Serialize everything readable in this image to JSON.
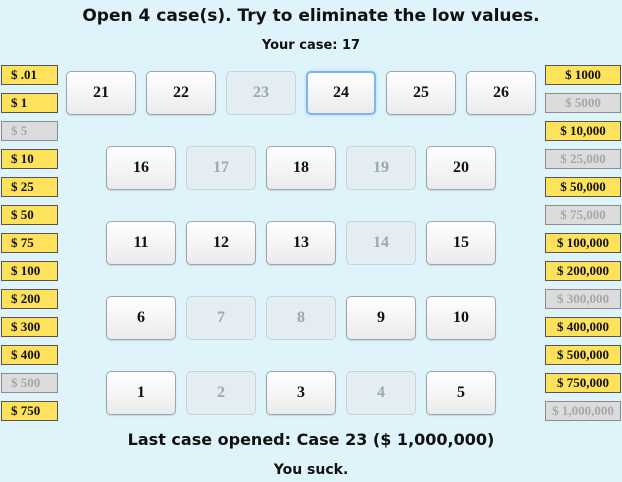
{
  "header": {
    "title": "Open 4 case(s). Try to eliminate the low values.",
    "your_case": "Your case: 17"
  },
  "footer": {
    "last_case": "Last case opened: Case 23 ($ 1,000,000)",
    "verdict": "You suck."
  },
  "colors": {
    "background": "#dff3fb",
    "prize_remaining": "#ffe25b",
    "prize_eliminated": "#dcdcdc",
    "selected_case_border": "#7fb6e6"
  },
  "prizes_left": [
    {
      "label": "$ .01",
      "eliminated": false
    },
    {
      "label": "$ 1",
      "eliminated": false
    },
    {
      "label": "$ 5",
      "eliminated": true
    },
    {
      "label": "$ 10",
      "eliminated": false
    },
    {
      "label": "$ 25",
      "eliminated": false
    },
    {
      "label": "$ 50",
      "eliminated": false
    },
    {
      "label": "$ 75",
      "eliminated": false
    },
    {
      "label": "$ 100",
      "eliminated": false
    },
    {
      "label": "$ 200",
      "eliminated": false
    },
    {
      "label": "$ 300",
      "eliminated": false
    },
    {
      "label": "$ 400",
      "eliminated": false
    },
    {
      "label": "$ 500",
      "eliminated": true
    },
    {
      "label": "$ 750",
      "eliminated": false
    }
  ],
  "prizes_right": [
    {
      "label": "$ 1000",
      "eliminated": false
    },
    {
      "label": "$ 5000",
      "eliminated": true
    },
    {
      "label": "$ 10,000",
      "eliminated": false
    },
    {
      "label": "$ 25,000",
      "eliminated": true
    },
    {
      "label": "$ 50,000",
      "eliminated": false
    },
    {
      "label": "$ 75,000",
      "eliminated": true
    },
    {
      "label": "$ 100,000",
      "eliminated": false
    },
    {
      "label": "$ 200,000",
      "eliminated": false
    },
    {
      "label": "$ 300,000",
      "eliminated": true
    },
    {
      "label": "$ 400,000",
      "eliminated": false
    },
    {
      "label": "$ 500,000",
      "eliminated": false
    },
    {
      "label": "$ 750,000",
      "eliminated": false
    },
    {
      "label": "$ 1,000,000",
      "eliminated": true
    }
  ],
  "cases": [
    {
      "number": "21",
      "opened": false,
      "selected": false
    },
    {
      "number": "22",
      "opened": false,
      "selected": false
    },
    {
      "number": "23",
      "opened": true,
      "selected": false
    },
    {
      "number": "24",
      "opened": false,
      "selected": true
    },
    {
      "number": "25",
      "opened": false,
      "selected": false
    },
    {
      "number": "26",
      "opened": false,
      "selected": false
    },
    {
      "number": "16",
      "opened": false,
      "selected": false
    },
    {
      "number": "17",
      "opened": true,
      "selected": false
    },
    {
      "number": "18",
      "opened": false,
      "selected": false
    },
    {
      "number": "19",
      "opened": true,
      "selected": false
    },
    {
      "number": "20",
      "opened": false,
      "selected": false
    },
    {
      "number": "11",
      "opened": false,
      "selected": false
    },
    {
      "number": "12",
      "opened": false,
      "selected": false
    },
    {
      "number": "13",
      "opened": false,
      "selected": false
    },
    {
      "number": "14",
      "opened": true,
      "selected": false
    },
    {
      "number": "15",
      "opened": false,
      "selected": false
    },
    {
      "number": "6",
      "opened": false,
      "selected": false
    },
    {
      "number": "7",
      "opened": true,
      "selected": false
    },
    {
      "number": "8",
      "opened": true,
      "selected": false
    },
    {
      "number": "9",
      "opened": false,
      "selected": false
    },
    {
      "number": "10",
      "opened": false,
      "selected": false
    },
    {
      "number": "1",
      "opened": false,
      "selected": false
    },
    {
      "number": "2",
      "opened": true,
      "selected": false
    },
    {
      "number": "3",
      "opened": false,
      "selected": false
    },
    {
      "number": "4",
      "opened": true,
      "selected": false
    },
    {
      "number": "5",
      "opened": false,
      "selected": false
    }
  ]
}
